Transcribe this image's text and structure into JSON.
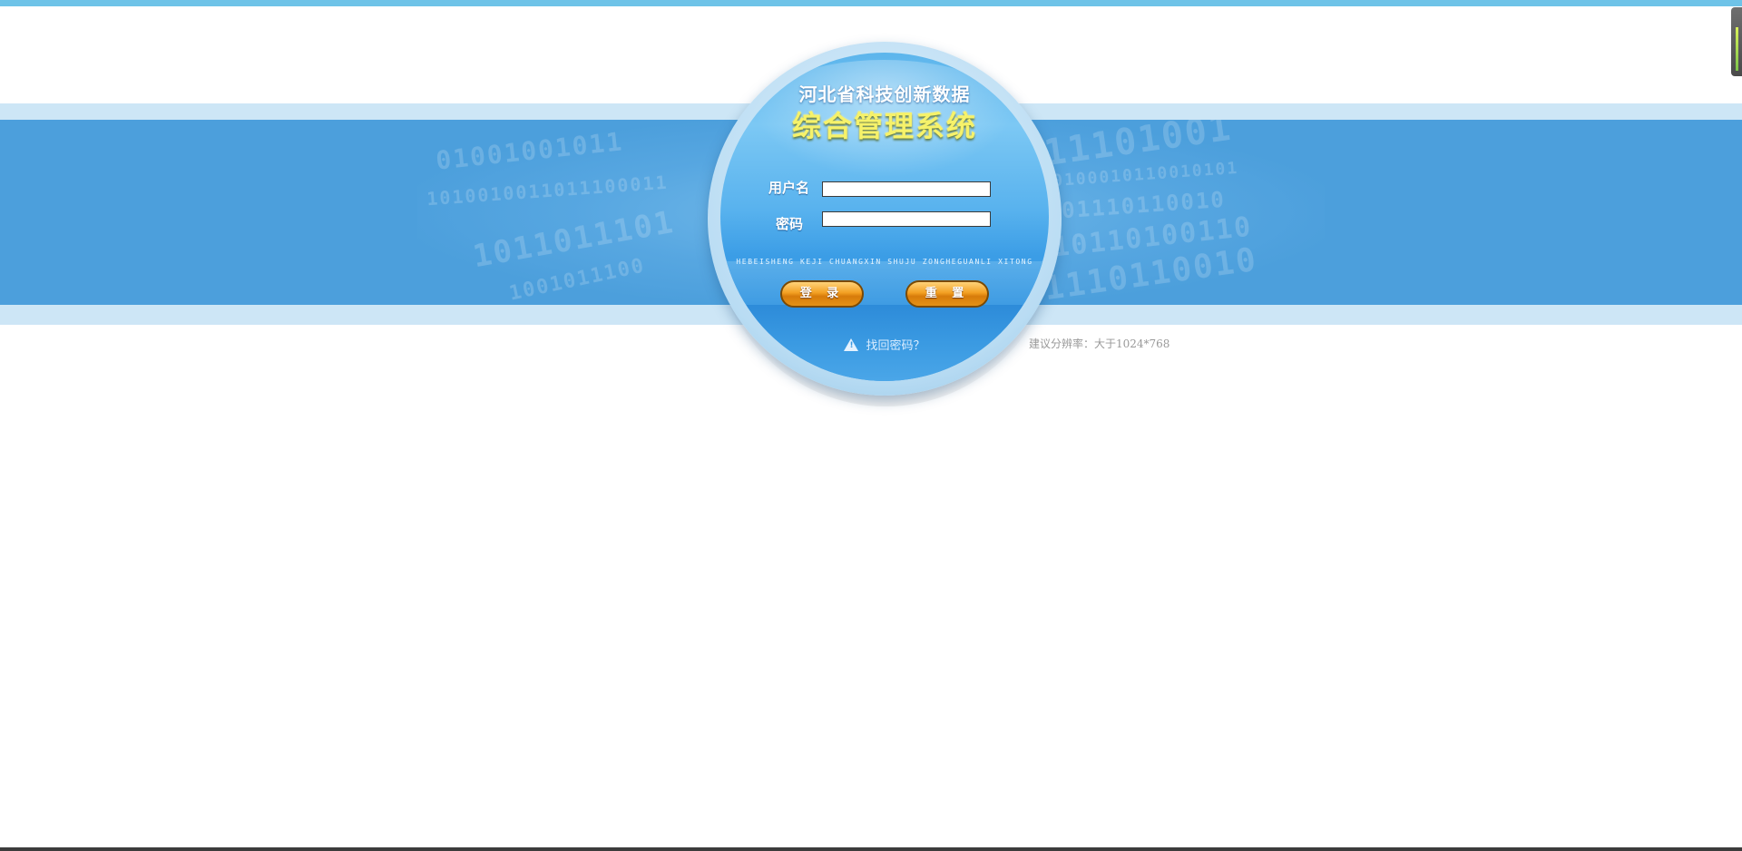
{
  "login": {
    "title_line1": "河北省科技创新数据",
    "title_line2": "综合管理系统",
    "username_label": "用户名",
    "password_label": "密码",
    "pinyin_subtitle": "HEBEISHENG KEJI CHUANGXIN SHUJU ZONGHEGUANLI XITONG",
    "login_button": "登 录",
    "reset_button": "重 置",
    "forgot_password": "找回密码？",
    "username_value": "",
    "password_value": ""
  },
  "resolution_note": "建议分辨率：大于1024*768",
  "colors": {
    "accent_blue": "#4c9fdc",
    "button_orange": "#f3a022",
    "title_yellow": "#f6f26a"
  },
  "icons": {
    "forgot": "warning-triangle-icon"
  }
}
